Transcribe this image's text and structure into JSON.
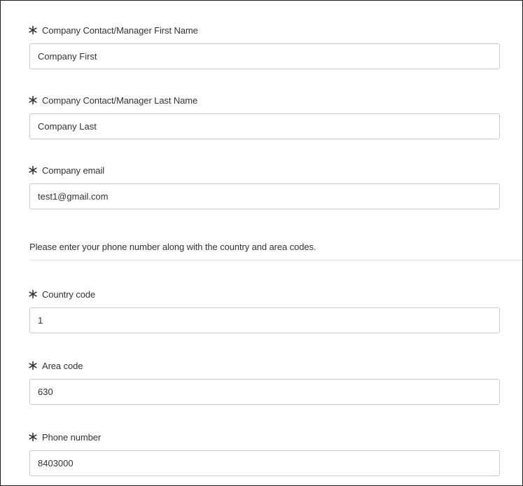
{
  "form": {
    "fields": [
      {
        "label": "Company Contact/Manager First Name",
        "value": "Company First",
        "required": true
      },
      {
        "label": "Company Contact/Manager Last Name",
        "value": "Company Last",
        "required": true
      },
      {
        "label": "Company email",
        "value": "test1@gmail.com",
        "required": true
      }
    ],
    "phone_hint": "Please enter your phone number along with the country and area codes.",
    "phone_fields": [
      {
        "label": "Country code",
        "value": "1",
        "required": true
      },
      {
        "label": "Area code",
        "value": "630",
        "required": true
      },
      {
        "label": "Phone number",
        "value": "8403000",
        "required": true
      }
    ]
  },
  "icons": {
    "required": "asterisk-icon"
  },
  "colors": {
    "text": "#333333",
    "input_border": "#c9c9c9",
    "divider": "#e3e3e3",
    "frame_border": "#1f1f1f"
  }
}
